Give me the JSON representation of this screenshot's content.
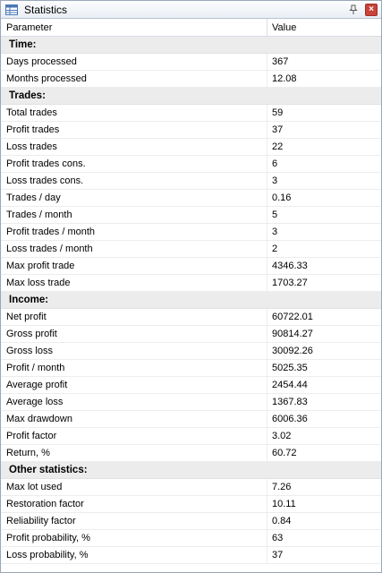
{
  "window": {
    "title": "Statistics"
  },
  "columns": {
    "parameter": "Parameter",
    "value": "Value"
  },
  "sections": [
    {
      "title": "Time:",
      "rows": [
        {
          "param": "Days processed",
          "value": "367"
        },
        {
          "param": "Months processed",
          "value": "12.08"
        }
      ]
    },
    {
      "title": "Trades:",
      "rows": [
        {
          "param": "Total trades",
          "value": "59"
        },
        {
          "param": "Profit trades",
          "value": "37"
        },
        {
          "param": "Loss trades",
          "value": "22"
        },
        {
          "param": "Profit trades cons.",
          "value": "6"
        },
        {
          "param": "Loss trades cons.",
          "value": "3"
        },
        {
          "param": "Trades / day",
          "value": "0.16"
        },
        {
          "param": "Trades / month",
          "value": "5"
        },
        {
          "param": "Profit trades / month",
          "value": "3"
        },
        {
          "param": "Loss trades / month",
          "value": "2"
        },
        {
          "param": "Max profit trade",
          "value": "4346.33"
        },
        {
          "param": "Max loss trade",
          "value": "1703.27"
        }
      ]
    },
    {
      "title": "Income:",
      "rows": [
        {
          "param": "Net profit",
          "value": "60722.01"
        },
        {
          "param": "Gross profit",
          "value": "90814.27"
        },
        {
          "param": "Gross loss",
          "value": "30092.26"
        },
        {
          "param": "Profit / month",
          "value": "5025.35"
        },
        {
          "param": "Average profit",
          "value": "2454.44"
        },
        {
          "param": "Average loss",
          "value": "1367.83"
        },
        {
          "param": "Max drawdown",
          "value": "6006.36"
        },
        {
          "param": "Profit factor",
          "value": "3.02"
        },
        {
          "param": "Return, %",
          "value": "60.72"
        }
      ]
    },
    {
      "title": "Other statistics:",
      "rows": [
        {
          "param": "Max lot used",
          "value": "7.26"
        },
        {
          "param": "Restoration factor",
          "value": "10.11"
        },
        {
          "param": "Reliability factor",
          "value": "0.84"
        },
        {
          "param": "Profit probability, %",
          "value": "63"
        },
        {
          "param": "Loss probability, %",
          "value": "37"
        }
      ]
    }
  ]
}
